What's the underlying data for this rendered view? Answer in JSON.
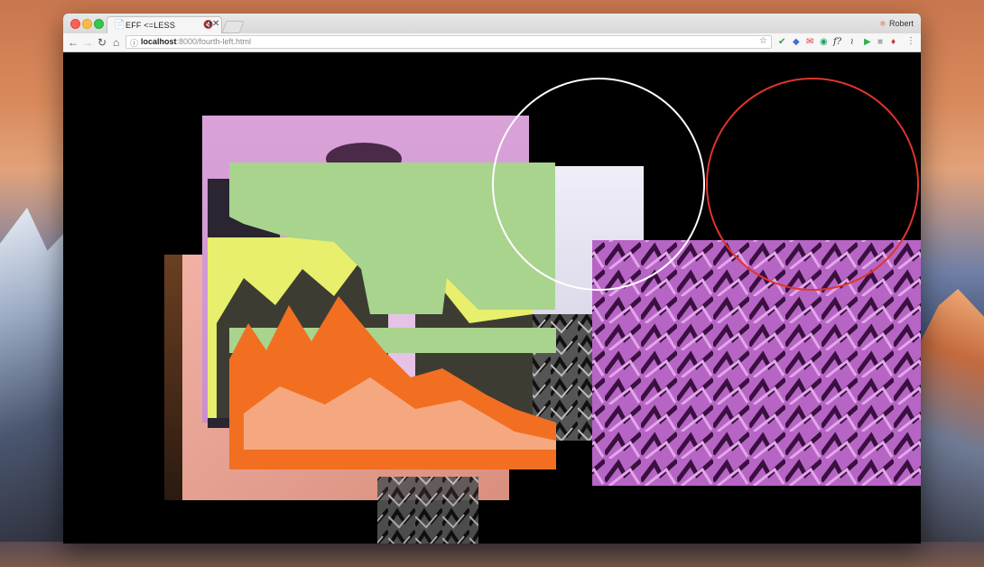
{
  "browser": {
    "tab_title": "EFF <=LESS",
    "profile_name": "Robert",
    "url_host": "localhost",
    "url_rest": ":8000/fourth-left.html"
  },
  "icons": {
    "back": "back-arrow-icon",
    "forward": "forward-arrow-icon",
    "reload": "reload-icon",
    "home": "home-icon",
    "info": "info-icon",
    "star": "bookmark-star-icon",
    "menu": "kebab-menu-icon"
  },
  "colors": {
    "white_circle": "#ffffff",
    "red_circle": "#e0352b",
    "green_shape": "#a8d48e",
    "orange_mountain": "#f26f21",
    "pink_panel": "#e2a7dd",
    "magenta_panel": "#c06fcf",
    "yellow": "#e7ef6c"
  }
}
